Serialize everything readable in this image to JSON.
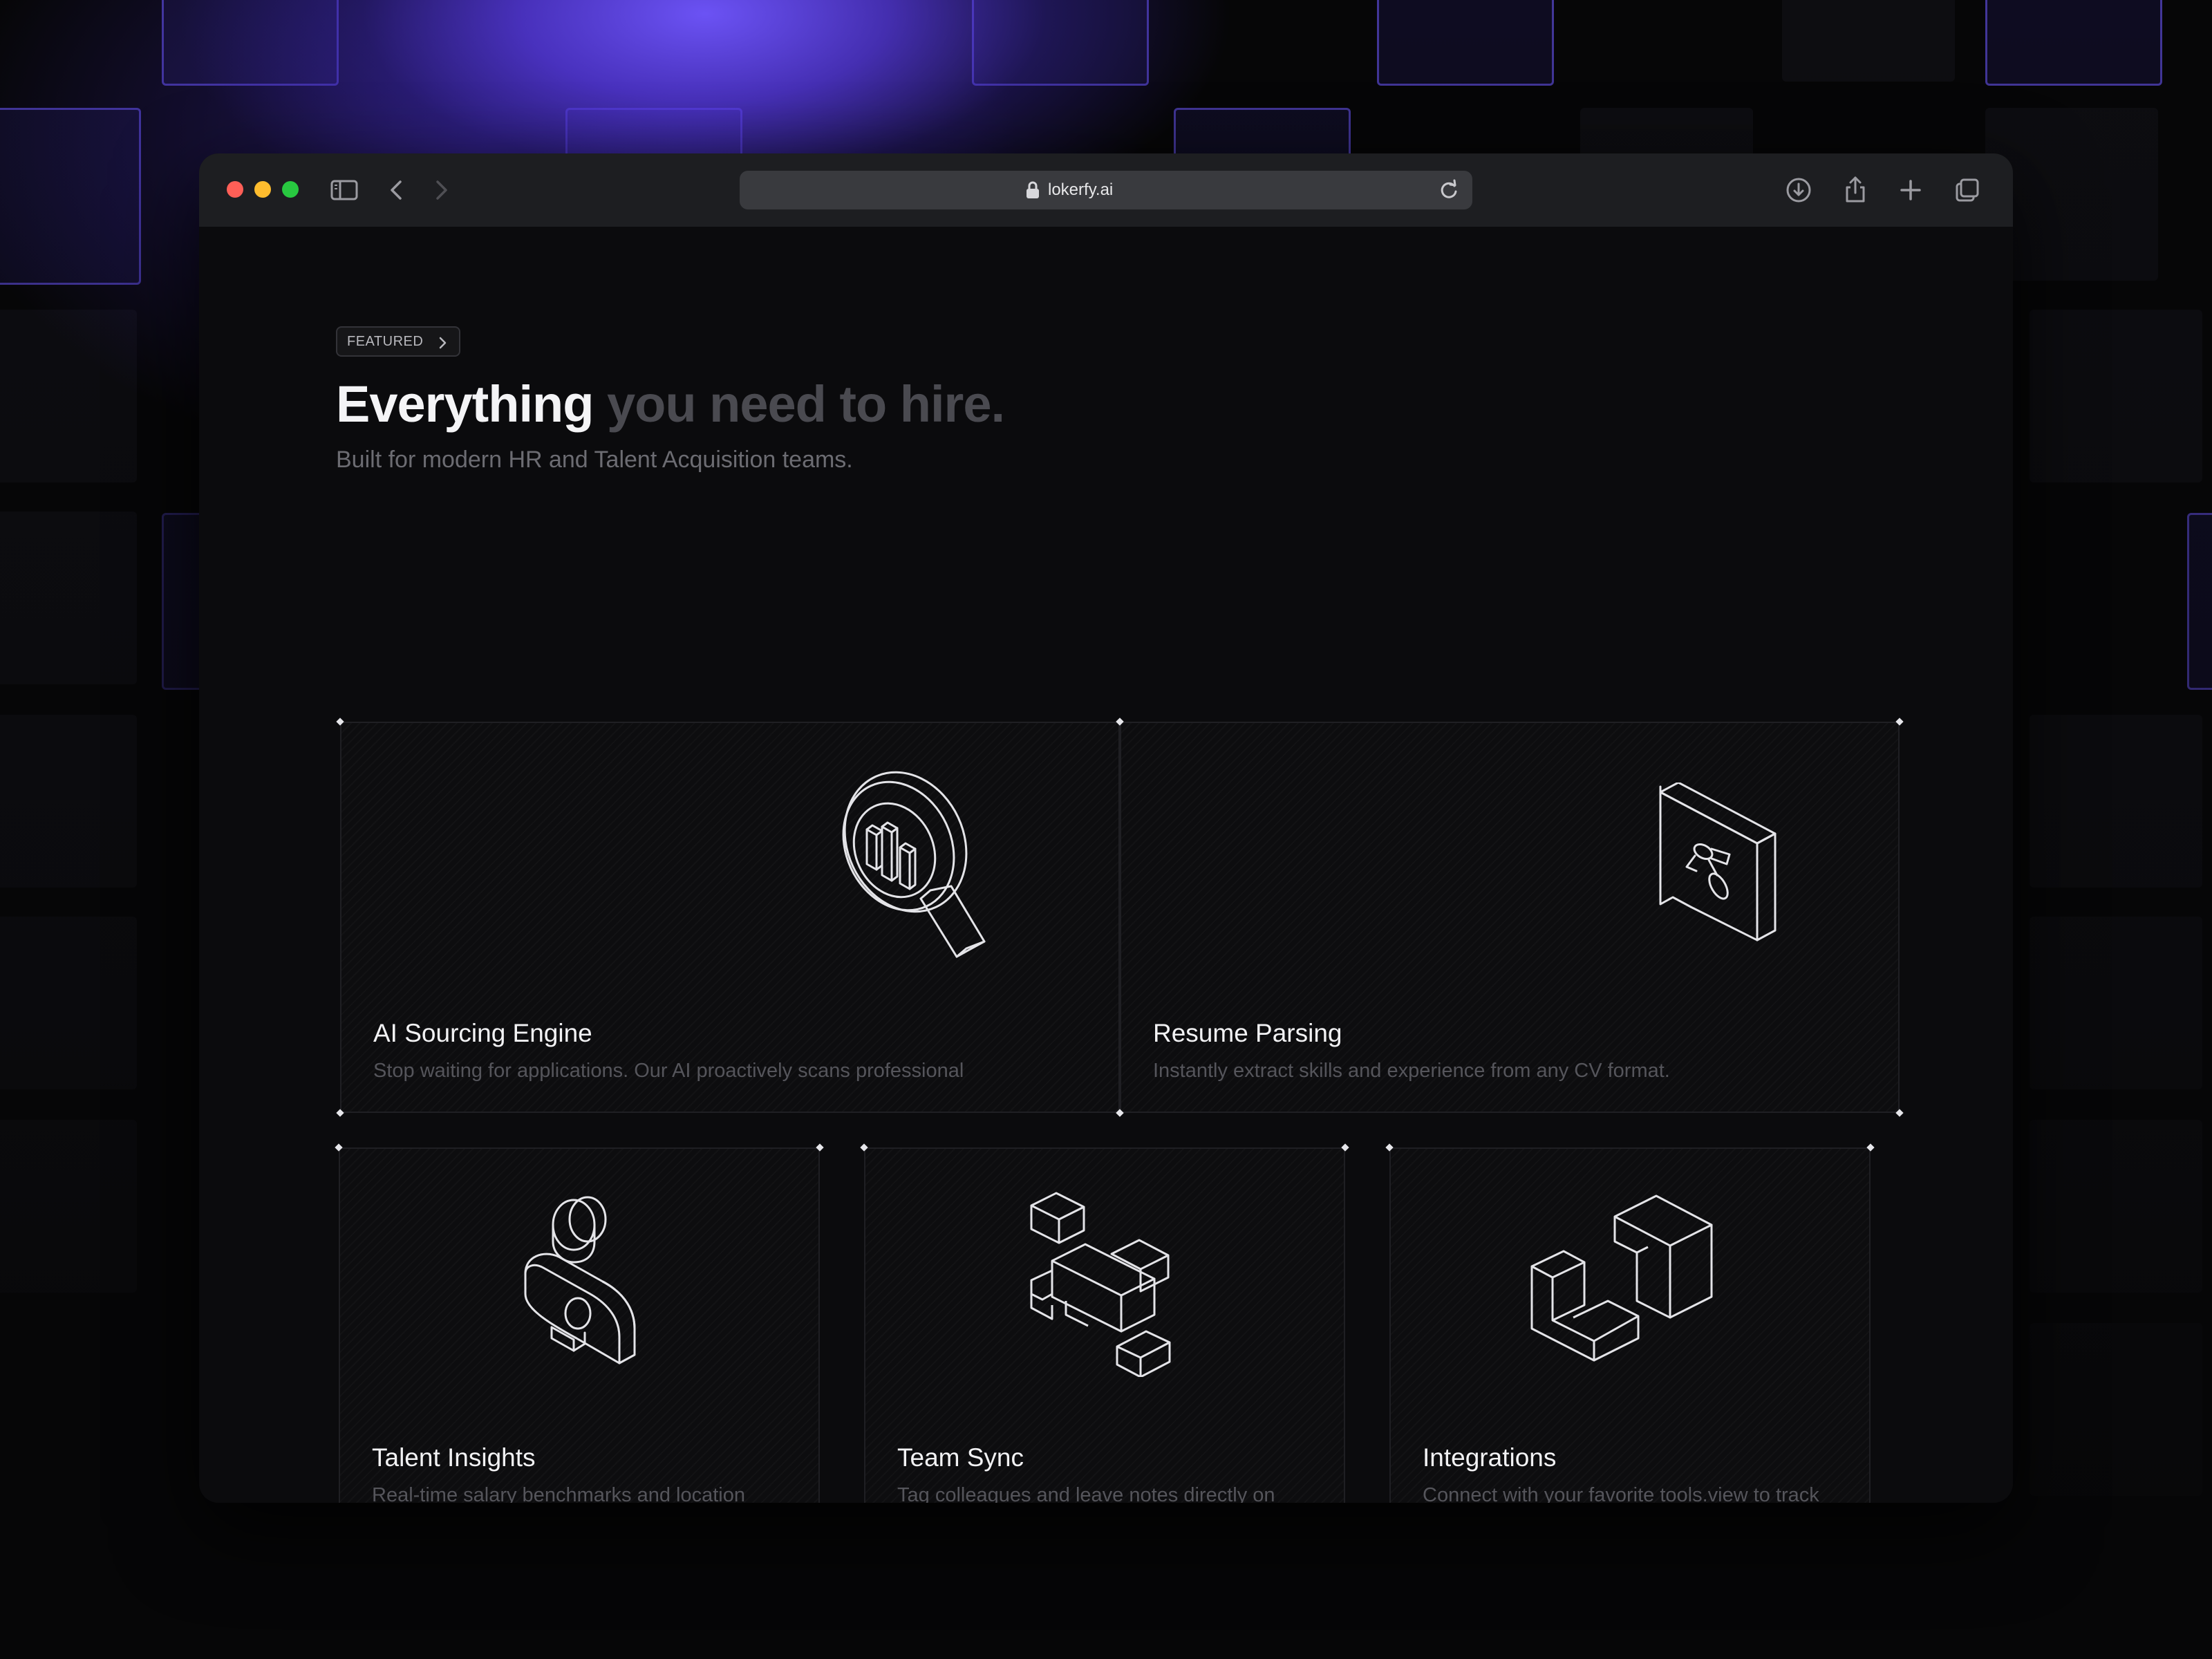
{
  "browser": {
    "url": "lokerfy.ai",
    "traffic_lights": {
      "close": "#ff5f57",
      "minimize": "#febc2e",
      "maximize": "#28c840"
    },
    "toolbar_icons": [
      "sidebar-toggle-icon",
      "back-arrow-icon",
      "forward-arrow-icon",
      "privacy-shield-icon",
      "lock-icon",
      "reload-icon",
      "download-icon",
      "share-icon",
      "new-tab-plus-icon",
      "tab-overview-icon"
    ]
  },
  "hero": {
    "badge": "FEATURED",
    "headline_strong": "Everything",
    "headline_muted": "you need to hire.",
    "subtitle": "Built for modern HR and Talent Acquisition teams."
  },
  "features": [
    {
      "title": "AI Sourcing Engine",
      "description": "Stop waiting for applications. Our AI proactively scans professional",
      "icon": "magnifier-chart-icon"
    },
    {
      "title": "Resume Parsing",
      "description": "Instantly extract skills and experience from any CV format.",
      "icon": "document-tag-icon"
    },
    {
      "title": "Talent Insights",
      "description": "Real-time salary benchmarks and location data.",
      "icon": "person-profile-icon"
    },
    {
      "title": "Team Sync",
      "description": "Tag colleagues and leave notes directly on profiles.",
      "icon": "blocks-cluster-icon"
    },
    {
      "title": "Integrations",
      "description": "Connect with your favorite tools.view to track candidates from",
      "icon": "connected-blocks-icon"
    }
  ],
  "colors": {
    "accent_glow": "#7056ff",
    "heading": "#f4f4f6",
    "heading_muted": "#4a4a50",
    "body_muted": "#55555b"
  }
}
